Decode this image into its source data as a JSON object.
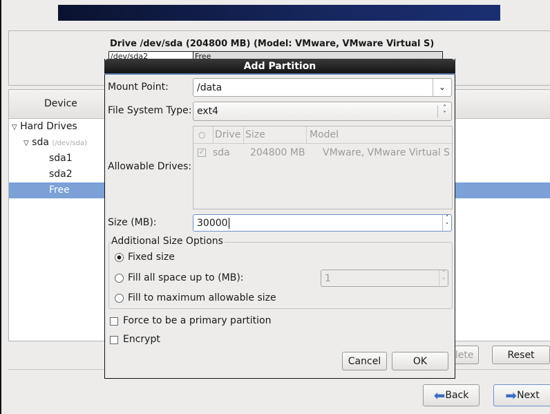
{
  "drive_panel": {
    "title": "Drive /dev/sda (204800 MB) (Model: VMware, VMware Virtual S)",
    "segments": [
      "/dev/sda2",
      "Free"
    ]
  },
  "tree": {
    "header": "Device",
    "items": [
      {
        "label": "Hard Drives"
      },
      {
        "label": "sda",
        "sub": "(/dev/sda)"
      },
      {
        "label": "sda1"
      },
      {
        "label": "sda2"
      },
      {
        "label": "Free",
        "selected": true
      }
    ]
  },
  "buttons": {
    "delete": "Delete",
    "reset": "Reset",
    "back": "Back",
    "next": "Next"
  },
  "dialog": {
    "title": "Add Partition",
    "mount_point_label": "Mount Point:",
    "mount_point": "/data",
    "fs_type_label": "File System Type:",
    "fs_type": "ext4",
    "drives_label": "Allowable Drives:",
    "drives_columns": [
      "Drive",
      "Size",
      "Model"
    ],
    "drives": [
      {
        "checked": true,
        "drive": "sda",
        "size": "204800 MB",
        "model": "VMware, VMware Virtual S"
      }
    ],
    "size_label": "Size (MB):",
    "size": "30000",
    "size_options_legend": "Additional Size Options",
    "options": [
      "Fixed size",
      "Fill all space up to (MB):",
      "Fill to maximum allowable size"
    ],
    "selected_option": "Fixed size",
    "fill_up_to": "1",
    "primary_label": "Force to be a primary partition",
    "primary_checked": false,
    "encrypt_label": "Encrypt",
    "encrypt_checked": false,
    "cancel": "Cancel",
    "ok": "OK"
  },
  "colors": {
    "selection": "#7ba1d6",
    "title_bar": "#1e1e1e"
  }
}
